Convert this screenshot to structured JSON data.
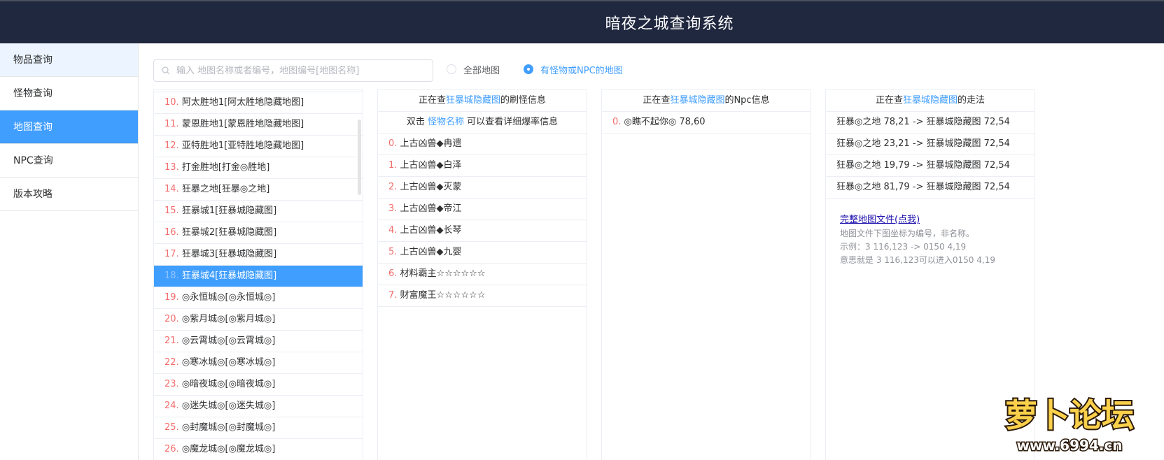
{
  "header": {
    "title": "暗夜之城查询系统"
  },
  "sidebar": {
    "items": [
      {
        "label": "物品查询"
      },
      {
        "label": "怪物查询"
      },
      {
        "label": "地图查询"
      },
      {
        "label": "NPC查询"
      },
      {
        "label": "版本攻略"
      }
    ],
    "active_index": 2
  },
  "search": {
    "placeholder": "输入 地图名称或者编号，地图编号[地图名称]",
    "value": ""
  },
  "filter": {
    "options": [
      {
        "label": "全部地图",
        "checked": false
      },
      {
        "label": "有怪物或NPC的地图",
        "checked": true
      }
    ]
  },
  "map_list": {
    "items": [
      {
        "num": "10",
        "name": "阿太胜地1[阿太胜地隐藏地图]"
      },
      {
        "num": "11",
        "name": "蒙恩胜地1[蒙恩胜地隐藏地图]"
      },
      {
        "num": "12",
        "name": "亚特胜地1[亚特胜地隐藏地图]"
      },
      {
        "num": "13",
        "name": "打金胜地[打金◎胜地]"
      },
      {
        "num": "14",
        "name": "狂暴之地[狂暴◎之地]"
      },
      {
        "num": "15",
        "name": "狂暴城1[狂暴城隐藏图]"
      },
      {
        "num": "16",
        "name": "狂暴城2[狂暴城隐藏图]"
      },
      {
        "num": "17",
        "name": "狂暴城3[狂暴城隐藏图]"
      },
      {
        "num": "18",
        "name": "狂暴城4[狂暴城隐藏图]"
      },
      {
        "num": "19",
        "name": "◎永恒城◎[◎永恒城◎]"
      },
      {
        "num": "20",
        "name": "◎紫月城◎[◎紫月城◎]"
      },
      {
        "num": "21",
        "name": "◎云霄城◎[◎云霄城◎]"
      },
      {
        "num": "22",
        "name": "◎寒冰城◎[◎寒冰城◎]"
      },
      {
        "num": "23",
        "name": "◎暗夜城◎[◎暗夜城◎]"
      },
      {
        "num": "24",
        "name": "◎迷失城◎[◎迷失城◎]"
      },
      {
        "num": "25",
        "name": "◎封魔城◎[◎封魔城◎]"
      },
      {
        "num": "26",
        "name": "◎魔龙城◎[◎魔龙城◎]"
      }
    ],
    "selected_num": "18"
  },
  "monster_panel": {
    "head_prefix": "正在查",
    "map_name": "狂暴城隐藏图",
    "head_suffix": "的刷怪信息",
    "hint_prefix": "双击 ",
    "hint_link": "怪物名称",
    "hint_suffix": " 可以查看详细爆率信息",
    "items": [
      {
        "num": "0",
        "name": "上古凶兽◆冉遗"
      },
      {
        "num": "1",
        "name": "上古凶兽◆白泽"
      },
      {
        "num": "2",
        "name": "上古凶兽◆灭蒙"
      },
      {
        "num": "3",
        "name": "上古凶兽◆帝江"
      },
      {
        "num": "4",
        "name": "上古凶兽◆长琴"
      },
      {
        "num": "5",
        "name": "上古凶兽◆九婴"
      },
      {
        "num": "6",
        "name": "材料霸主☆☆☆☆☆☆"
      },
      {
        "num": "7",
        "name": "财富魔王☆☆☆☆☆☆"
      }
    ]
  },
  "npc_panel": {
    "head_prefix": "正在查",
    "map_name": "狂暴城隐藏图",
    "head_suffix": "的Npc信息",
    "items": [
      {
        "num": "0",
        "name": "◎瞧不起你◎ 78,60"
      }
    ]
  },
  "route_panel": {
    "head_prefix": "正在查",
    "map_name": "狂暴城隐藏图",
    "head_suffix": "的走法",
    "routes": [
      "狂暴◎之地 78,21 -> 狂暴城隐藏图 72,54",
      "狂暴◎之地 23,21 -> 狂暴城隐藏图 72,54",
      "狂暴◎之地 19,79 -> 狂暴城隐藏图 72,54",
      "狂暴◎之地 81,79 -> 狂暴城隐藏图 72,54"
    ],
    "link_text": "完整地图文件(点我)",
    "note_lines": [
      "地图文件下图坐标为编号，非名称。",
      "示例：3 116,123 -> 0150 4,19",
      "意思就是 3 116,123可以进入0150 4,19"
    ]
  },
  "watermark": {
    "text": "萝卜论坛",
    "url": "www.6994.cn"
  },
  "colors": {
    "header_bg": "#20283f",
    "accent": "#409eff",
    "index_number": "#f56c6c",
    "border": "#ebeef5"
  }
}
